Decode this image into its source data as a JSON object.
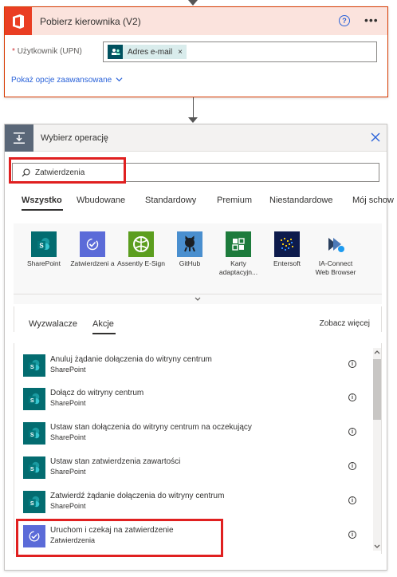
{
  "card1": {
    "title": "Pobierz kierownika (V2)",
    "field_label": "Użytkownik (UPN)",
    "field_required": "*",
    "token_label": "Adres e-mail",
    "token_remove": "×",
    "advanced_link": "Pokaż opcje zaawansowane",
    "brand_color": "#ea3e23",
    "icons": [
      "office-icon",
      "help-icon",
      "more-icon",
      "chevron-down-icon"
    ]
  },
  "card2": {
    "title": "Wybierz operację",
    "search_value": "Zatwierdzenia",
    "tabs": [
      "Wszystko",
      "Wbudowane",
      "Standardowy",
      "Premium",
      "Niestandardowe",
      "Mój schow"
    ],
    "active_tab": "Wszystko",
    "connectors": [
      {
        "label": "SharePoint",
        "icon": "sharepoint-icon"
      },
      {
        "label": "Zatwierdzeni a",
        "icon": "approvals-icon"
      },
      {
        "label": "Assently E-Sign",
        "icon": "assently-icon"
      },
      {
        "label": "GitHub",
        "icon": "github-icon"
      },
      {
        "label": "Karty adaptacyjn...",
        "icon": "adaptive-cards-icon"
      },
      {
        "label": "Entersoft",
        "icon": "entersoft-icon"
      },
      {
        "label": "IA-Connect Web Browser",
        "icon": "ia-connect-icon"
      }
    ],
    "subtabs": [
      "Wyzwalacze",
      "Akcje"
    ],
    "active_subtab": "Akcje",
    "see_more": "Zobacz więcej",
    "actions": [
      {
        "title": "Anuluj żądanie dołączenia do witryny centrum",
        "sub": "SharePoint"
      },
      {
        "title": "Dołącz do witryny centrum",
        "sub": "SharePoint"
      },
      {
        "title": "Ustaw stan dołączenia do witryny centrum na oczekujący",
        "sub": "SharePoint"
      },
      {
        "title": "Ustaw stan zatwierdzenia zawartości",
        "sub": "SharePoint"
      },
      {
        "title": "Zatwierdź żądanie dołączenia do witryny centrum",
        "sub": "SharePoint"
      },
      {
        "title": "Uruchom i czekaj na zatwierdzenie",
        "sub": "Zatwierdzenia"
      }
    ],
    "info_glyph": "i"
  }
}
